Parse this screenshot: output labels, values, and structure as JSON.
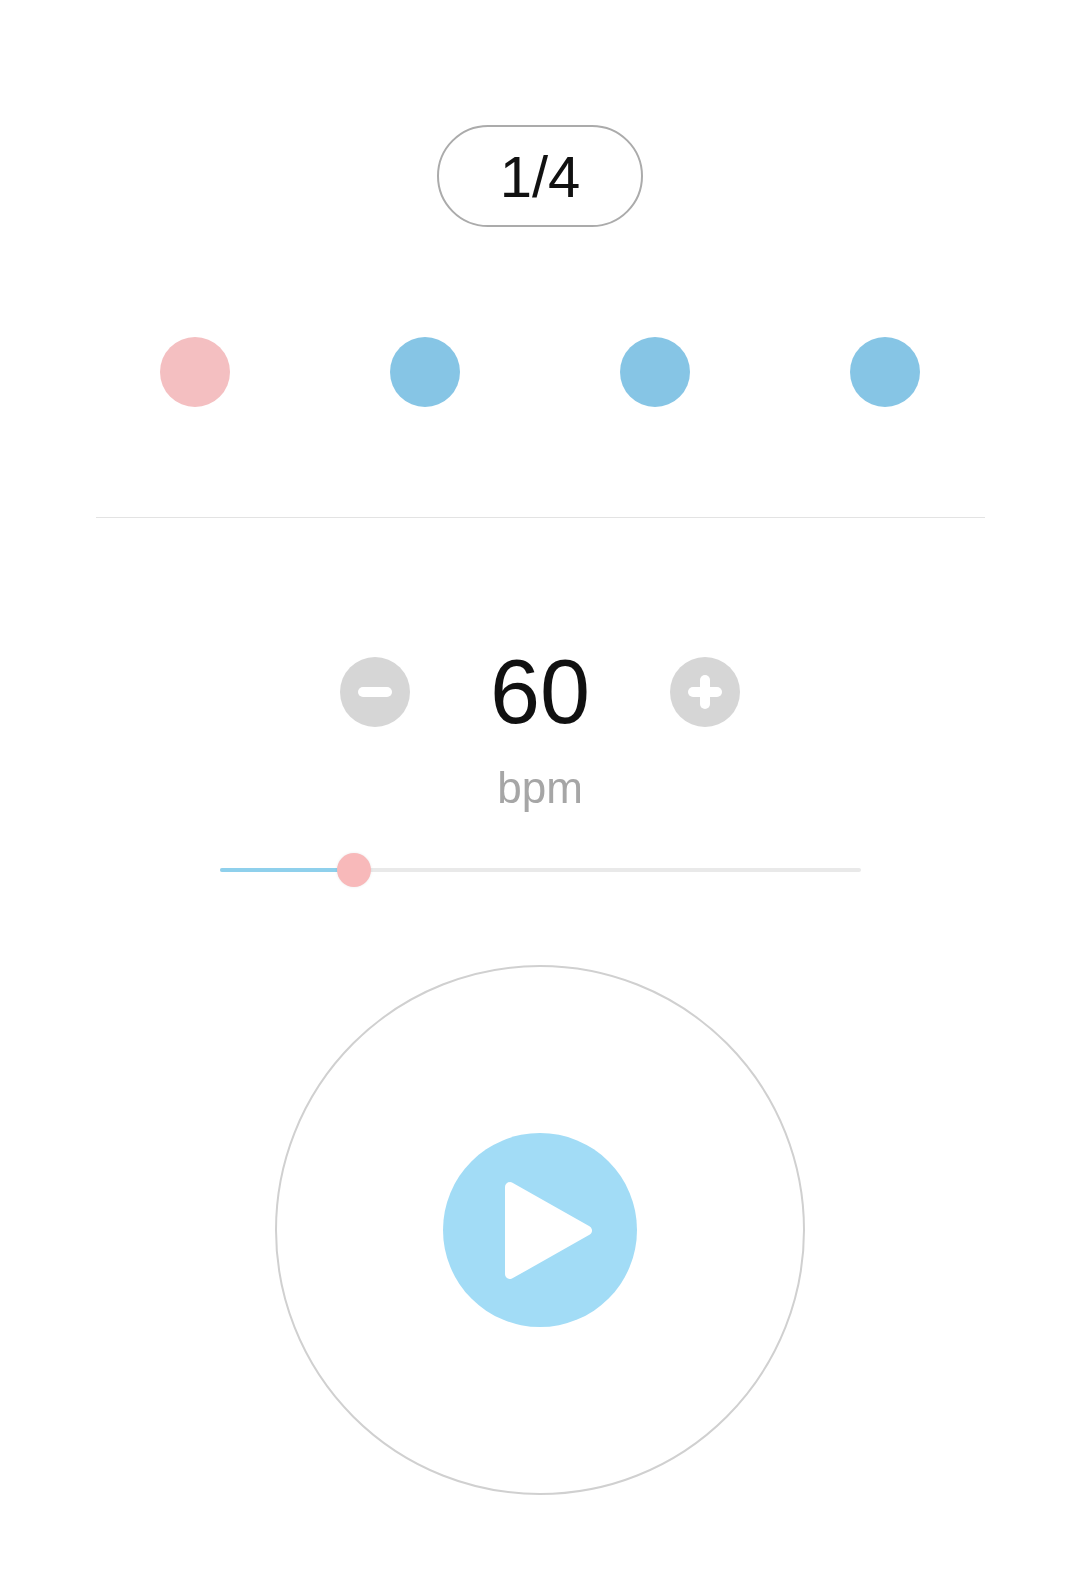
{
  "time_signature": {
    "label": "1/4"
  },
  "beats": [
    {
      "color": "#f4bfc1"
    },
    {
      "color": "#86c5e5"
    },
    {
      "color": "#86c5e5"
    },
    {
      "color": "#86c5e5"
    }
  ],
  "tempo": {
    "value": "60",
    "unit": "bpm",
    "slider": {
      "level": 0.21
    }
  },
  "player": {
    "playing": false
  }
}
